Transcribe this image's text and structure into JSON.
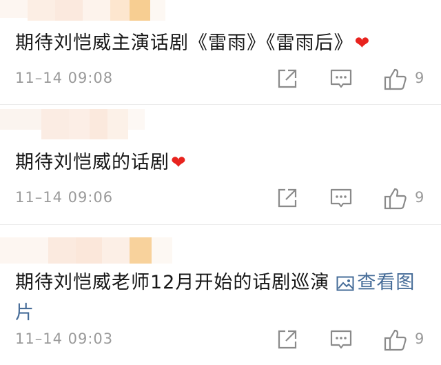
{
  "comments": [
    {
      "text": "期待刘恺威主演话剧《雷雨》《雷雨后》",
      "emoji": "❤",
      "time": "11–14 09:08",
      "likes": "9"
    },
    {
      "text": "期待刘恺威的话剧",
      "emoji": "❤",
      "time": "11–14 09:06",
      "likes": "9"
    },
    {
      "text": "期待刘恺威老师12月开始的话剧巡演",
      "link_text": "查看图片",
      "time": "11–14 09:03",
      "likes": "9"
    }
  ],
  "icons": {
    "share": "share-icon",
    "reply": "comment-icon",
    "like": "thumbs-up-icon",
    "picture": "picture-icon"
  },
  "colors": {
    "text": "#161616",
    "meta": "#9a9a9a",
    "link": "#466c98",
    "heart": "#e8231e",
    "divider": "#ebebeb"
  }
}
